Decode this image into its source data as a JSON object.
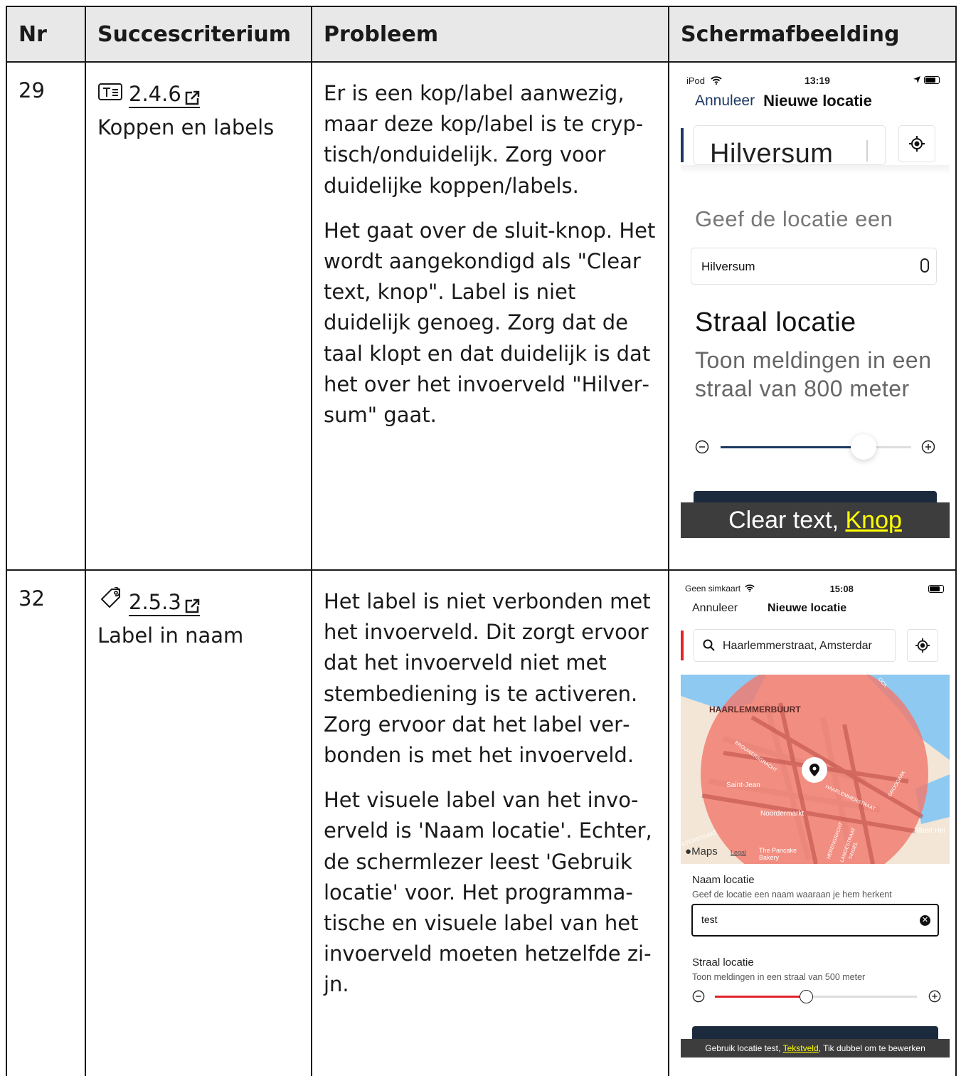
{
  "headers": {
    "nr": "Nr",
    "criterion": "Succescriterium",
    "problem": "Probleem",
    "screenshot": "Schermafbeelding"
  },
  "rows": [
    {
      "nr": "29",
      "criterion_code": "2.4.6",
      "criterion_name": "Koppen en labels",
      "criterion_icon": "text-field-icon",
      "problem_p1": "Er is een kop/label aanwezig, maar deze kop/label is te cryp­tisch/onduidelijk. Zorg voor duidelijke koppen/labels.",
      "problem_p2": "Het gaat over de sluit-knop. Het wordt aangekondigd als \"Clear text, knop\". Label is niet duidelijk genoeg. Zorg dat de taal klopt en dat duidelijk is dat het over het invoerveld \"Hilver­sum\" gaat.",
      "screen": {
        "status_left": "iPod",
        "status_time": "13:19",
        "cancel": "Annuleer",
        "title": "Nieuwe locatie",
        "search_value": "Hilversum",
        "label_hint": "Geef de locatie een",
        "field_value": "Hilversum",
        "section_title": "Straal locatie",
        "section_desc": "Toon meldingen in een straal van 800 meter",
        "slider_fraction": 0.75,
        "voiceover_text": "Clear text, ",
        "voiceover_role": "Knop"
      }
    },
    {
      "nr": "32",
      "criterion_code": "2.5.3",
      "criterion_name": "Label in naam",
      "criterion_icon": "tag-icon",
      "problem_p1": "Het label is niet verbonden met het invoerveld. Dit zorgt ervoor dat het invoerveld niet met stembediening is te activeren. Zorg ervoor dat het label ver­bonden is met het invoerveld.",
      "problem_p2": "Het visuele label van het invo­erveld is 'Naam locatie'. Echter, de schermlezer leest 'Gebruik locatie' voor. Het programma­tische en visuele label van het invoerveld moeten hetzelfde zi­jn.",
      "screen": {
        "status_left": "Geen simkaart",
        "status_time": "15:08",
        "cancel": "Annuleer",
        "title": "Nieuwe locatie",
        "search_value": "Haarlemmerstraat, Amsterdar",
        "map_labels": [
          "HAARLEMMERBUURT",
          "BROUWERSGRACHT",
          "Saint-Jean",
          "Noordermarkt",
          "HAARLEMMERSTRAAT",
          "DROOGBAK",
          "Albert Hei",
          "The Pancake Bakery",
          "SINGEL",
          "HERENGRACHT",
          "LANGESTRAAT",
          "STERSTRAAT",
          "OCK"
        ],
        "maps_brand": "Maps",
        "legal": "Legal",
        "name_label": "Naam locatie",
        "name_hint": "Geef de locatie een naam waaraan je hem herkent",
        "name_value": "test",
        "section_title": "Straal locatie",
        "section_desc": "Toon meldingen in een straal van 500 meter",
        "slider_fraction": 0.45,
        "voiceover_pre": "Gebruik locatie test, ",
        "voiceover_role": "Tekstveld",
        "voiceover_post": ", Tik dubbel om te bewerken"
      }
    }
  ],
  "colors": {
    "header_bg": "#e8e8e8",
    "navy": "#1e3a63",
    "red": "#e0252b",
    "highlight": "#ffff00",
    "map_overlay": "#f27a6e"
  }
}
